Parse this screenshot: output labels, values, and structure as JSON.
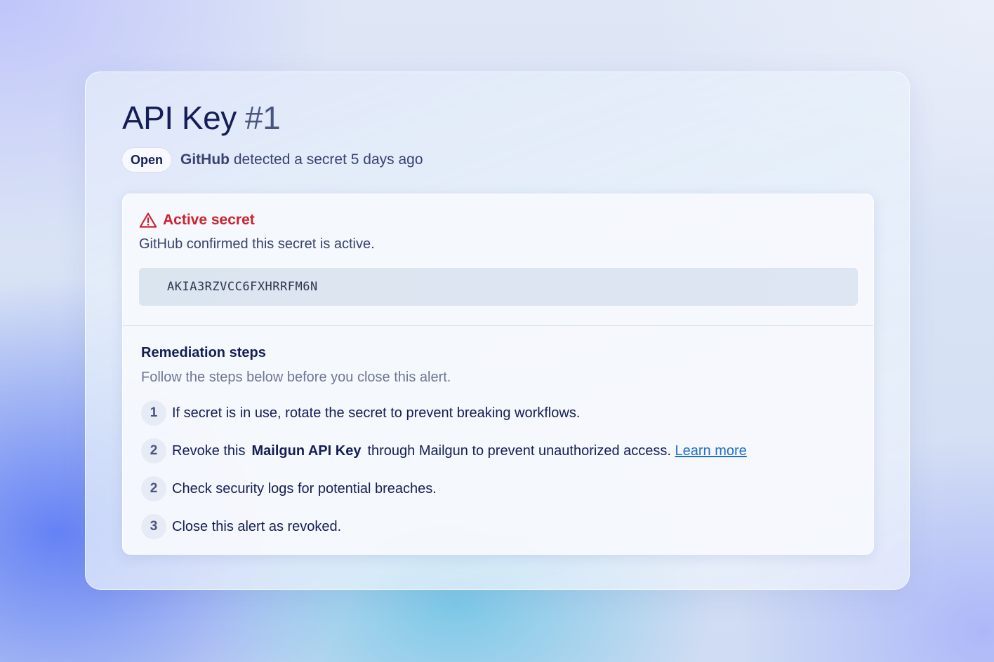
{
  "panel": {
    "title": "API Key",
    "title_number": "#1",
    "status_badge": "Open",
    "source": "GitHub",
    "detected_text": "detected a secret 5 days ago"
  },
  "alert": {
    "icon": "warning-triangle-icon",
    "title": "Active secret",
    "description": "GitHub confirmed this secret is active.",
    "secret_value": "AKIA3RZVCC6FXHRRFM6N",
    "title_color": "#cf222e"
  },
  "remediation": {
    "title": "Remediation steps",
    "subtitle": "Follow the steps below before you close this alert.",
    "steps": [
      {
        "num": "1",
        "text": "If secret is in use, rotate the secret to prevent breaking workflows."
      },
      {
        "num": "2",
        "text_before": "Revoke this",
        "text_strong": "Mailgun API Key",
        "text_after": "through Mailgun to prevent unauthorized access.",
        "link": "Learn more"
      },
      {
        "num": "2",
        "text": "Check security logs for potential breaches."
      },
      {
        "num": "3",
        "text": "Close this alert as revoked."
      }
    ]
  },
  "colors": {
    "heading": "#141e55",
    "link": "#1f6fc5"
  }
}
